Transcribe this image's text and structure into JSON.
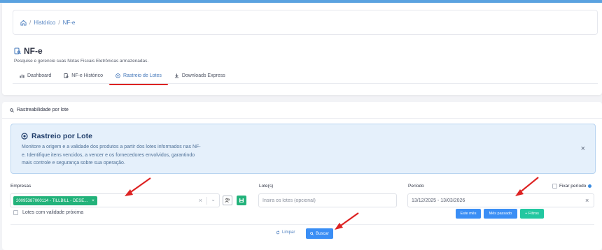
{
  "breadcrumb": {
    "home_icon": "home-icon",
    "items": [
      "Histórico",
      "NF-e"
    ],
    "separator": "/"
  },
  "page": {
    "title": "NF-e",
    "subtitle": "Pesquise e gerencie suas Notas Fiscais Eletrônicas armazenadas.",
    "tabs": [
      {
        "label": "Dashboard",
        "icon": "bar-chart-icon"
      },
      {
        "label": "NF-e Histórico",
        "icon": "receipt-icon"
      },
      {
        "label": "Rastreio de Lotes",
        "icon": "target-icon",
        "active": true
      },
      {
        "label": "Downloads Express",
        "icon": "download-icon"
      }
    ]
  },
  "card": {
    "header": "Rastreabilidade por lote"
  },
  "info": {
    "title": "Rastreio por Lote",
    "lines": [
      "Monitore a origem e a validade dos produtos a partir dos lotes informados nas NF-",
      "e. Identifique itens vencidos, a vencer e os fornecedores envolvidos, garantindo",
      "mais controle e segurança sobre sua operação."
    ],
    "close": "×"
  },
  "form": {
    "empresas_label": "Empresas",
    "empresa_chip": "20095387000114 - TILLBILL - DESE...",
    "chip_remove": "×",
    "clear": "×",
    "chevron": "⌄",
    "lotes_validade": "Lotes com validade próxima",
    "lotes_label": "Lote(s)",
    "lotes_placeholder": "Insira os lotes (opcional)",
    "periodo_label": "Período",
    "periodo_value": "13/12/2025 - 13/03/2026",
    "periodo_clear": "×",
    "fixar_label": "Fixar período",
    "btn_este_mes": "Este mês",
    "btn_mes_passado": "Mês passado",
    "btn_filtros": "+ Filtros",
    "limpar": "Limpar",
    "buscar": "Buscar"
  },
  "colors": {
    "accent": "#3a8ef5",
    "green": "#22b27a",
    "annotation": "#dd2222",
    "info_bg": "#e5f0fb"
  }
}
